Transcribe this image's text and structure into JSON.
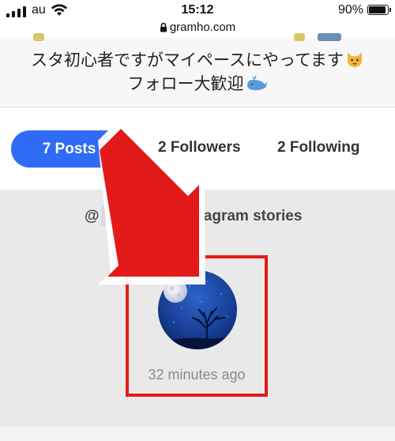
{
  "status_bar": {
    "carrier": "au",
    "time": "15:12",
    "battery": "90%",
    "battery_level": 0.9,
    "url": "gramho.com"
  },
  "profile": {
    "bio_lines": [
      "スタ初心者ですがマイペースにやってます",
      "フォロー大歓迎"
    ],
    "bio_emojis": [
      "cat-face-emoji",
      "whale-emoji"
    ]
  },
  "tabs": {
    "posts": "7 Posts",
    "followers": "2 Followers",
    "following": "2 Following",
    "active": "posts"
  },
  "stories": {
    "username_prefix": "@",
    "title": "Instagram stories",
    "items": [
      {
        "time": "32 minutes ago"
      }
    ]
  },
  "annotation": {
    "arrow_color": "#e21a1a",
    "box_color": "#e21a1a"
  },
  "colors": {
    "accent": "#2f6bf5",
    "story_bg": "#e9e9e9"
  }
}
